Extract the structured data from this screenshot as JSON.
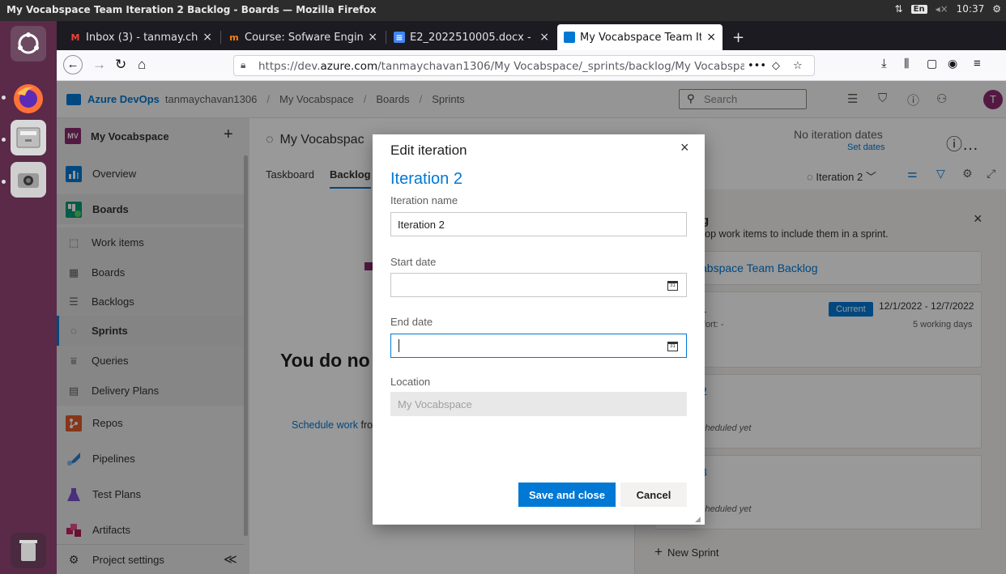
{
  "os": {
    "window_title": "My Vocabspace Team Iteration 2 Backlog - Boards — Mozilla Firefox",
    "keyboard": "En",
    "time": "10:37"
  },
  "browser": {
    "tabs": [
      {
        "label": "Inbox (3) - tanmay.chava",
        "icon": "gmail-icon",
        "color": "#ea4335"
      },
      {
        "label": "Course: Sofware Engine",
        "icon": "moodle-icon",
        "color": "#f98012"
      },
      {
        "label": "E2_2022510005.docx - C",
        "icon": "docs-icon",
        "color": "#4285f4"
      },
      {
        "label": "My Vocabspace Team Ite",
        "icon": "azure-devops-icon",
        "color": "#0078d4",
        "active": true
      }
    ],
    "url_prefix": "https://dev.",
    "url_domain": "azure.com",
    "url_path": "/tanmaychavan1306/My Vocabspace/_sprints/backlog/My Vocabspace Tear",
    "url_more": "•••"
  },
  "ado": {
    "product": "Azure DevOps",
    "breadcrumbs": [
      "tanmaychavan1306",
      "My Vocabspace",
      "Boards",
      "Sprints"
    ],
    "search_placeholder": "Search",
    "avatar_initial": "T"
  },
  "nav": {
    "project_initials": "MV",
    "project_name": "My Vocabspace",
    "add_symbol": "+",
    "items": [
      {
        "label": "Overview",
        "icon": "overview-icon"
      },
      {
        "label": "Boards",
        "icon": "boards-icon"
      },
      {
        "label": "Work items",
        "icon": "work-items-icon"
      },
      {
        "label": "Boards",
        "icon": "kanban-icon"
      },
      {
        "label": "Backlogs",
        "icon": "backlogs-icon"
      },
      {
        "label": "Sprints",
        "icon": "sprints-icon"
      },
      {
        "label": "Queries",
        "icon": "queries-icon"
      },
      {
        "label": "Delivery Plans",
        "icon": "delivery-plans-icon"
      },
      {
        "label": "Repos",
        "icon": "repos-icon"
      },
      {
        "label": "Pipelines",
        "icon": "pipelines-icon"
      },
      {
        "label": "Test Plans",
        "icon": "test-plans-icon"
      },
      {
        "label": "Artifacts",
        "icon": "artifacts-icon"
      }
    ],
    "settings_label": "Project settings",
    "collapse_symbol": "≪"
  },
  "main": {
    "team_title": "My Vocabspac",
    "tabs": [
      "Taskboard",
      "Backlog"
    ],
    "no_dates": "No iteration dates",
    "set_dates": "Set dates",
    "iteration_picker": "Iteration 2",
    "empty_heading": "You do no",
    "schedule_link": "Schedule work",
    "schedule_rest": "fro",
    "planning": {
      "heading_fragment": "g",
      "hint": "rop work items to include them in a sprint.",
      "backlog_label": "abspace Team Backlog",
      "sprints": [
        {
          "name": "1",
          "badge": "Current",
          "dates": "12/1/2022 - 12/7/2022",
          "effort": "ffort: -",
          "days": "5 working days"
        },
        {
          "name": "2",
          "status": "cheduled yet"
        },
        {
          "name": "3",
          "status": "cheduled yet"
        }
      ],
      "new_sprint": "New Sprint"
    }
  },
  "dialog": {
    "title": "Edit iteration",
    "iteration_heading": "Iteration 2",
    "name_label": "Iteration name",
    "name_value": "Iteration 2",
    "start_label": "Start date",
    "start_value": "",
    "end_label": "End date",
    "end_value": "",
    "calendar_day": "31",
    "location_label": "Location",
    "location_value": "My Vocabspace",
    "save_label": "Save and close",
    "cancel_label": "Cancel",
    "close_symbol": "×"
  }
}
